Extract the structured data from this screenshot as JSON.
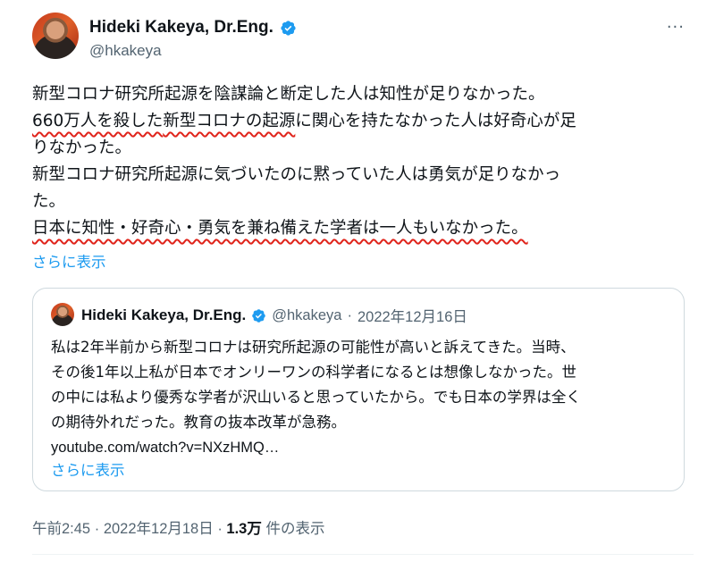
{
  "author": {
    "display_name": "Hideki Kakeya, Dr.Eng.",
    "handle": "@hkakeya",
    "verified_color": "#1d9bf0"
  },
  "more_menu": "···",
  "tweet": {
    "line1": "新型コロナ研究所起源を陰謀論と断定した人は知性が足りなかった。",
    "line2_underlined_a": "660万人を殺した",
    "line2_underlined_b": "新型コロナの起源",
    "line2_rest": "に関心を持たなかった人は好奇心が足",
    "line3": "りなかった。",
    "line4": "新型コロナ研究所起源に気づいたのに黙っていた人は勇気が足りなかっ",
    "line5": "た。",
    "line6_underlined": "日本に知性・好奇心・勇気を兼ね備えた学者は一人もいなかった。",
    "show_more": "さらに表示"
  },
  "quote": {
    "display_name": "Hideki Kakeya, Dr.Eng.",
    "handle": "@hkakeya",
    "separator": "·",
    "date": "2022年12月16日",
    "line1": "私は2年半前から新型コロナは研究所起源の可能性が高いと訴えてきた。当時、",
    "line2": "その後1年以上私が日本でオンリーワンの科学者になるとは想像しなかった。世",
    "line3": "の中には私より優秀な学者が沢山いると思っていたから。でも日本の学界は全く",
    "line4": "の期待外れだった。教育の抜本改革が急務。",
    "link": "youtube.com/watch?v=NXzHMQ…",
    "show_more": "さらに表示"
  },
  "meta": {
    "time": "午前2:45",
    "sep1": "·",
    "date": "2022年12月18日",
    "sep2": "·",
    "views_count": "1.3万",
    "views_label": "件の表示"
  },
  "colors": {
    "accent": "#1d9bf0",
    "underline": "#e0241b",
    "secondary_text": "#536471"
  }
}
